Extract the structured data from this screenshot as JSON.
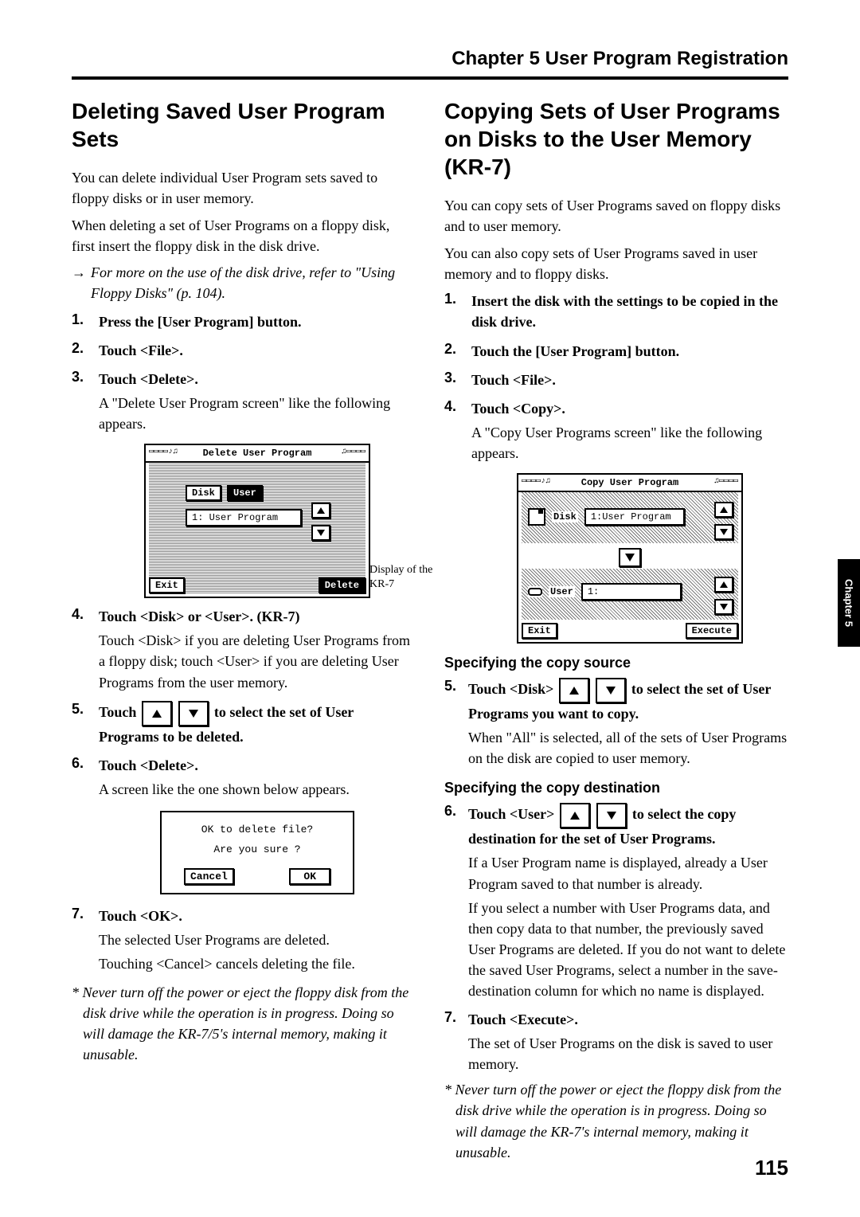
{
  "header": {
    "chapter": "Chapter 5 User Program Registration"
  },
  "sideTab": "Chapter 5",
  "pageNumber": "115",
  "left": {
    "title": "Deleting Saved User Program Sets",
    "p1": "You can delete individual User Program sets saved to floppy disks or in user memory.",
    "p2": "When deleting a set of User Programs on a floppy disk, first insert the floppy disk in the disk drive.",
    "xref": "For more on the use of the disk drive, refer to \"Using Floppy Disks\" (p. 104).",
    "steps": {
      "s1": "Press the [User Program] button.",
      "s2": "Touch <File>.",
      "s3": "Touch <Delete>.",
      "s3note": "A \"Delete User Program screen\" like the following appears.",
      "s4": "Touch <Disk> or <User>. (KR-7)",
      "s4note": "Touch <Disk> if you are deleting User Programs from a floppy disk; touch <User> if you are deleting User Programs from the user memory.",
      "s5a": "Touch ",
      "s5b": " to select the set of User Programs to be deleted.",
      "s6": "Touch <Delete>.",
      "s6note": "A screen like the one shown below appears.",
      "s7": "Touch <OK>.",
      "s7note1": "The selected User Programs are deleted.",
      "s7note2": "Touching <Cancel> cancels deleting the file."
    },
    "screenCaption": "Display of the KR-7",
    "lcd1": {
      "title": "Delete User Program",
      "disk": "Disk",
      "user": "User",
      "item": "1: User Program",
      "exit": "Exit",
      "delete": "Delete"
    },
    "dialog": {
      "line1": "OK to delete file?",
      "line2": "Are you sure ?",
      "cancel": "Cancel",
      "ok": "OK"
    },
    "footnote": "Never turn off the power or eject the floppy disk from the disk drive while the operation is in progress. Doing so will damage the KR-7/5's internal memory, making it unusable."
  },
  "right": {
    "title": "Copying Sets of User Programs on Disks to the User Memory (KR-7)",
    "p1": "You can copy sets of User Programs saved on floppy disks and to user memory.",
    "p2": "You can also copy sets of User Programs saved in user memory and to floppy disks.",
    "steps": {
      "s1": "Insert the disk with the settings to be copied in the disk drive.",
      "s2": "Touch the [User Program] button.",
      "s3": "Touch <File>.",
      "s4": "Touch <Copy>.",
      "s4note": "A \"Copy User Programs screen\" like the following appears.",
      "s5a": "Touch <Disk> ",
      "s5b": " to select the set of User Programs you want to copy.",
      "s5note": "When \"All\" is selected, all of the sets of User Programs on the disk are copied to user memory.",
      "s6a": "Touch <User> ",
      "s6b": " to select the copy destination for the set of User Programs.",
      "s6note1": "If a User Program name is displayed, already a User Program saved to that number is already.",
      "s6note2": "If you select a number with User Programs data, and then copy data to that number, the previously saved User Programs are deleted. If you do not want to delete the saved User Programs, select a number in the save-destination column for which no name is displayed.",
      "s7": "Touch <Execute>.",
      "s7note": "The set of User Programs on the disk is saved to user memory."
    },
    "sub1": "Specifying the copy source",
    "sub2": "Specifying the copy destination",
    "lcd2": {
      "title": "Copy User Program",
      "disk": "Disk",
      "diskItem": "1:User Program",
      "user": "User",
      "userItem": "1:",
      "exit": "Exit",
      "execute": "Execute"
    },
    "footnote": "Never turn off the power or eject the floppy disk from the disk drive while the operation is in progress. Doing so will damage the KR-7's internal memory, making it unusable."
  }
}
